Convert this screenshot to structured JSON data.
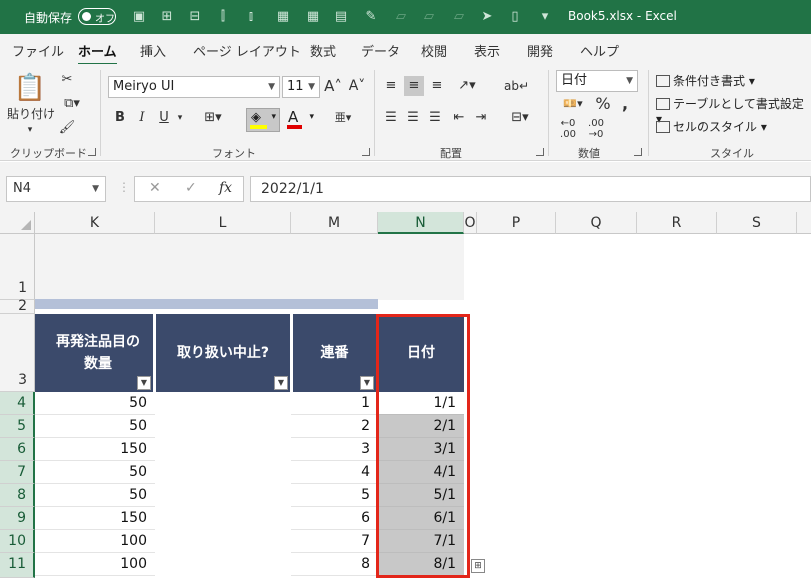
{
  "titlebar": {
    "autosave_label": "自動保存",
    "autosave_state": "オフ",
    "doc_title": "Book5.xlsx  -  Excel"
  },
  "tabs": [
    "ファイル",
    "ホーム",
    "挿入",
    "ページ レイアウト",
    "数式",
    "データ",
    "校閲",
    "表示",
    "開発",
    "ヘルプ"
  ],
  "active_tab": "ホーム",
  "ribbon": {
    "clipboard": {
      "paste_label": "貼り付け",
      "group_label": "クリップボード"
    },
    "font": {
      "font_name": "Meiryo UI",
      "font_size": "11",
      "bold": "B",
      "italic": "I",
      "underline": "U",
      "group_label": "フォント"
    },
    "alignment": {
      "group_label": "配置"
    },
    "number": {
      "format": "日付",
      "group_label": "数値"
    },
    "styles": {
      "conditional": "条件付き書式",
      "table": "テーブルとして書式設定",
      "cell_styles": "セルのスタイル",
      "group_label": "スタイル"
    }
  },
  "formula_bar": {
    "name_box": "N4",
    "formula": "2022/1/1"
  },
  "columns": [
    "K",
    "L",
    "M",
    "N",
    "O",
    "P",
    "Q",
    "R",
    "S"
  ],
  "selected_column": "N",
  "rows": [
    "1",
    "2",
    "3",
    "4",
    "5",
    "6",
    "7",
    "8",
    "9",
    "10",
    "11"
  ],
  "headers": {
    "k": "再発注品目の数量",
    "l": "取り扱い中止?",
    "m": "連番",
    "n": "日付"
  },
  "table_rows": [
    {
      "qty": "50",
      "seq": "1",
      "date": "1/1"
    },
    {
      "qty": "50",
      "seq": "2",
      "date": "2/1"
    },
    {
      "qty": "150",
      "seq": "3",
      "date": "3/1"
    },
    {
      "qty": "50",
      "seq": "4",
      "date": "4/1"
    },
    {
      "qty": "50",
      "seq": "5",
      "date": "5/1"
    },
    {
      "qty": "150",
      "seq": "6",
      "date": "6/1"
    },
    {
      "qty": "100",
      "seq": "7",
      "date": "7/1"
    },
    {
      "qty": "100",
      "seq": "8",
      "date": "8/1"
    }
  ],
  "colors": {
    "excel_green": "#217346",
    "header_navy": "#3b4a6b",
    "selection_red": "#e3261a"
  }
}
